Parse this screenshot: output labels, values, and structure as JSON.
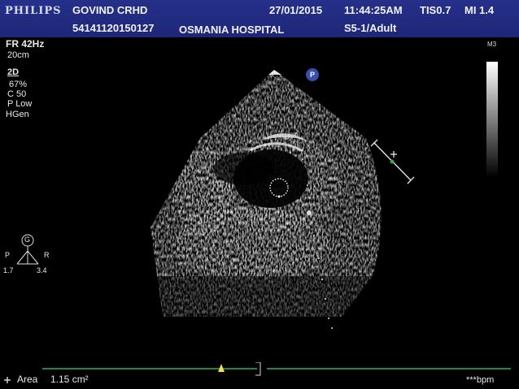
{
  "header": {
    "brand": "PHILIPS",
    "patient_name": "GOVIND CRHD",
    "patient_id": "54141120150127",
    "date": "27/01/2015",
    "time": "11:44:25AM",
    "tis": "TIS0.7",
    "mi": "MI 1.4",
    "institution": "OSMANIA HOSPITAL",
    "preset": "S5-1/Adult"
  },
  "readouts": {
    "frame_rate": "FR 42Hz",
    "depth": "20cm",
    "mode": "2D",
    "gain": "67%",
    "compression": "C 50",
    "power": "P Low",
    "harmonics": "HGen"
  },
  "orientation": {
    "center": "G",
    "left": "P",
    "right": "R",
    "bottom_left": "1.7",
    "bottom_right": "3.4"
  },
  "graybar": {
    "label": "M3"
  },
  "probe_marker": "P",
  "footer": {
    "measure_label": "Area",
    "measure_value": "1.15 cm²",
    "heart_rate": "***bpm"
  }
}
